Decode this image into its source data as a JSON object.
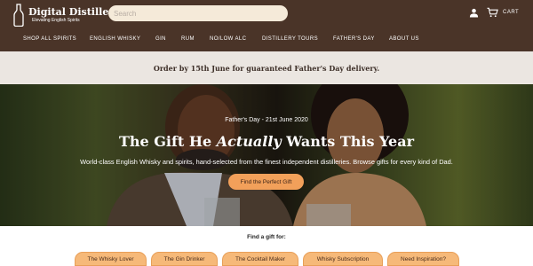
{
  "brand": {
    "name": "Digital Distiller",
    "tagline": "Elevating English Spirits"
  },
  "header": {
    "search_placeholder": "Search",
    "cart_label": "CART",
    "account_icon": "account-icon",
    "cart_icon": "cart-icon",
    "bg_color": "#4a3428"
  },
  "nav": {
    "items": [
      "SHOP ALL SPIRITS",
      "ENGLISH WHISKY",
      "GIN",
      "RUM",
      "NO/LOW ALC",
      "DISTILLERY TOURS",
      "FATHER'S DAY",
      "ABOUT US"
    ]
  },
  "announcement": {
    "text": "Order by 15th June for guaranteed Father's Day delivery."
  },
  "hero": {
    "eyebrow": "Father's Day - 21st June 2020",
    "title_before": "The Gift He ",
    "title_emphasis": "Actually",
    "title_after": " Wants This Year",
    "description": "World-class English Whisky and spirits, hand-selected from the finest independent distilleries. Browse gifts for every kind of Dad.",
    "cta_label": "Find the Perfect Gift",
    "accent_color": "#f2a05a"
  },
  "gift_finder": {
    "title": "Find a gift for:",
    "chips": [
      "The Whisky Lover",
      "The Gin Drinker",
      "The Cocktail Maker",
      "Whisky Subscription",
      "Need Inspiration?"
    ]
  }
}
